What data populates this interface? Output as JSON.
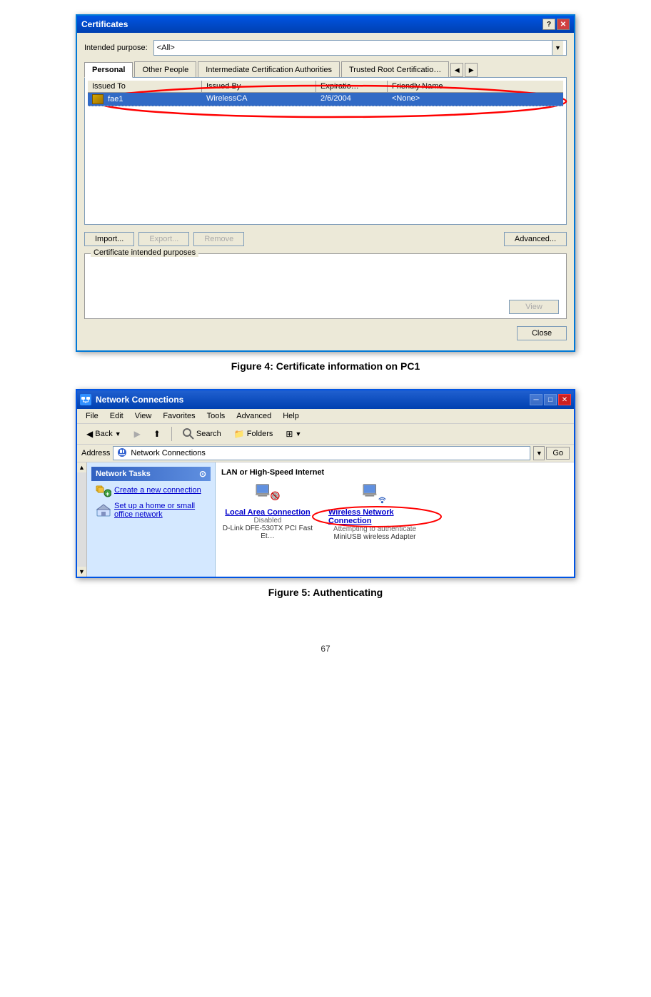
{
  "figure4": {
    "title": "Certificates",
    "intended_purpose_label": "Intended purpose:",
    "intended_purpose_value": "<All>",
    "tabs": [
      {
        "label": "Personal",
        "active": true
      },
      {
        "label": "Other People",
        "active": false
      },
      {
        "label": "Intermediate Certification Authorities",
        "active": false
      },
      {
        "label": "Trusted Root Certificatio…",
        "active": false
      }
    ],
    "columns": [
      "Issued To",
      "Issued By",
      "Expiratio…",
      "Friendly Name"
    ],
    "rows": [
      {
        "issued_to": "fae1",
        "issued_by": "WirelessCA",
        "expiration": "2/6/2004",
        "friendly_name": "<None>"
      }
    ],
    "buttons": {
      "import": "Import...",
      "export": "Export...",
      "remove": "Remove",
      "advanced": "Advanced..."
    },
    "group_label": "Certificate intended purposes",
    "view_btn": "View",
    "close_btn": "Close"
  },
  "figure4_caption": "Figure 4: Certificate information on PC1",
  "figure5": {
    "title": "Network Connections",
    "menu_items": [
      "File",
      "Edit",
      "View",
      "Favorites",
      "Tools",
      "Advanced",
      "Help"
    ],
    "toolbar": {
      "back": "Back",
      "forward": "",
      "search": "Search",
      "folders": "Folders"
    },
    "address_label": "Address",
    "address_value": "Network Connections",
    "go_btn": "Go",
    "sidebar": {
      "section_title": "Network Tasks",
      "links": [
        {
          "label": "Create a new connection"
        },
        {
          "label": "Set up a home or small office network"
        }
      ]
    },
    "section_title": "LAN or High-Speed Internet",
    "connections": [
      {
        "name": "Local Area Connection",
        "status": "Disabled",
        "desc": "D-Link DFE-530TX PCI Fast Et…"
      },
      {
        "name": "Wireless Network Connection",
        "status": "Attempting to authenticate",
        "desc": "MiniUSB wireless Adapter"
      }
    ]
  },
  "figure5_caption": "Figure 5: Authenticating",
  "page_number": "67"
}
